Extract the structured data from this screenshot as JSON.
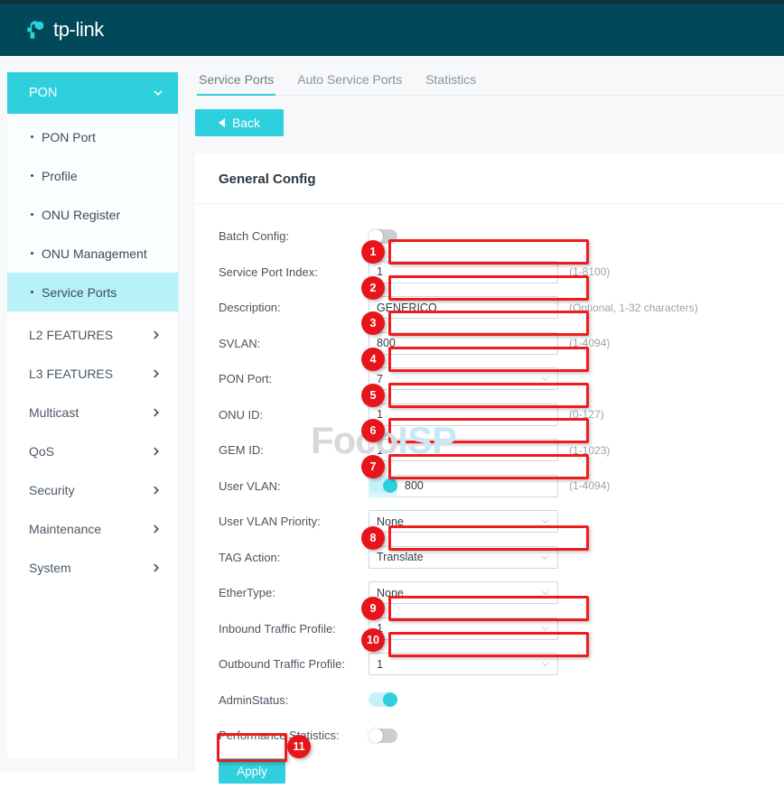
{
  "brand": {
    "name": "tp-link"
  },
  "sidebar": {
    "group": {
      "label": "PON",
      "icon": "chevron-down-icon"
    },
    "sub_items": [
      {
        "label": "PON Port",
        "active": false
      },
      {
        "label": "Profile",
        "active": false
      },
      {
        "label": "ONU Register",
        "active": false
      },
      {
        "label": "ONU Management",
        "active": false
      },
      {
        "label": "Service Ports",
        "active": true
      }
    ],
    "items": [
      {
        "label": "L2 FEATURES"
      },
      {
        "label": "L3 FEATURES"
      },
      {
        "label": "Multicast"
      },
      {
        "label": "QoS"
      },
      {
        "label": "Security"
      },
      {
        "label": "Maintenance"
      },
      {
        "label": "System"
      }
    ]
  },
  "tabs": [
    {
      "label": "Service Ports",
      "active": true
    },
    {
      "label": "Auto Service Ports",
      "active": false
    },
    {
      "label": "Statistics",
      "active": false
    }
  ],
  "back_button": {
    "label": "Back",
    "icon": "triangle-left-icon"
  },
  "panel": {
    "title": "General Config"
  },
  "fields": {
    "batch_config": {
      "label": "Batch Config:",
      "state": "off"
    },
    "service_port_index": {
      "label": "Service Port Index:",
      "value": "1",
      "hint": "(1-8100)"
    },
    "description": {
      "label": "Description:",
      "value": "GENERICO",
      "hint": "(Optional, 1-32 characters)"
    },
    "svlan": {
      "label": "SVLAN:",
      "value": "800",
      "hint": "(1-4094)"
    },
    "pon_port": {
      "label": "PON Port:",
      "value": "7",
      "hint": ""
    },
    "onu_id": {
      "label": "ONU ID:",
      "value": "1",
      "hint": "(0-127)"
    },
    "gem_id": {
      "label": "GEM ID:",
      "value": "1",
      "hint": "(1-1023)"
    },
    "user_vlan": {
      "label": "User VLAN:",
      "value": "800",
      "hint": "(1-4094)",
      "state": "on"
    },
    "user_vlan_priority": {
      "label": "User VLAN Priority:",
      "value": "None",
      "hint": ""
    },
    "tag_action": {
      "label": "TAG Action:",
      "value": "Translate",
      "hint": ""
    },
    "ethertype": {
      "label": "EtherType:",
      "value": "None",
      "hint": ""
    },
    "inbound_traffic_profile": {
      "label": "Inbound Traffic Profile:",
      "value": "1",
      "hint": ""
    },
    "outbound_traffic_profile": {
      "label": "Outbound Traffic Profile:",
      "value": "1",
      "hint": ""
    },
    "admin_status": {
      "label": "AdminStatus:",
      "state": "on"
    },
    "performance_statistics": {
      "label": "Performance Statistics:",
      "state": "off"
    }
  },
  "apply_button": {
    "label": "Apply"
  },
  "annotations": {
    "badges": [
      "1",
      "2",
      "3",
      "4",
      "5",
      "6",
      "7",
      "8",
      "9",
      "10",
      "11"
    ]
  },
  "watermark": {
    "part1": "Foco",
    "part2": "ISP"
  },
  "colors": {
    "header_bg": "#00485a",
    "accent": "#2fd0dd",
    "annotation_red": "#ee1c1c",
    "active_nav": "#b8f2f8"
  }
}
